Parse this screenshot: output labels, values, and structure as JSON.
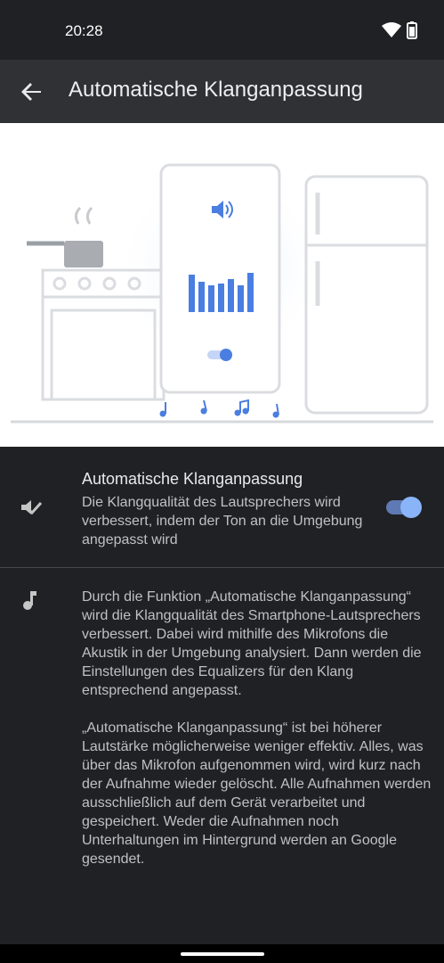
{
  "status_bar": {
    "time": "20:28",
    "icons": [
      "wifi-icon",
      "battery-icon"
    ]
  },
  "app_bar": {
    "back_icon": "arrow-left-icon",
    "title": "Automatische Klanganpassung"
  },
  "setting": {
    "icon": "adaptive-sound-icon",
    "title": "Automatische Klanganpassung",
    "summary": "Die Klangqualität des Lautsprechers wird verbessert, indem der Ton an die Umgebung angepasst wird",
    "enabled": true
  },
  "info": {
    "icon": "music-note-icon",
    "paragraph_1": "Durch die Funktion „Automatische Klanganpassung“ wird die Klangqualität des Smartphone-Lautsprechers verbessert. Dabei wird mithilfe des Mikrofons die Akustik in der Umgebung analysiert. Dann werden die Einstellungen des Equalizers für den Klang entsprechend angepasst.",
    "paragraph_2": "„Automatische Klanganpassung“ ist bei höherer Lautstärke möglicherweise weniger effektiv. Alles, was über das Mikrofon aufgenommen wird, wird kurz nach der Aufnahme wieder gelöscht. Alle Aufnahmen werden ausschließlich auf dem Gerät verarbeitet und gespeichert. Weder die Aufnahmen noch Unterhaltungen im Hintergrund werden an Google gesendet."
  },
  "colors": {
    "accent": "#8ab4f8",
    "illustration_blue": "#4a7ee0",
    "background": "#202124",
    "app_bar": "#303134"
  }
}
